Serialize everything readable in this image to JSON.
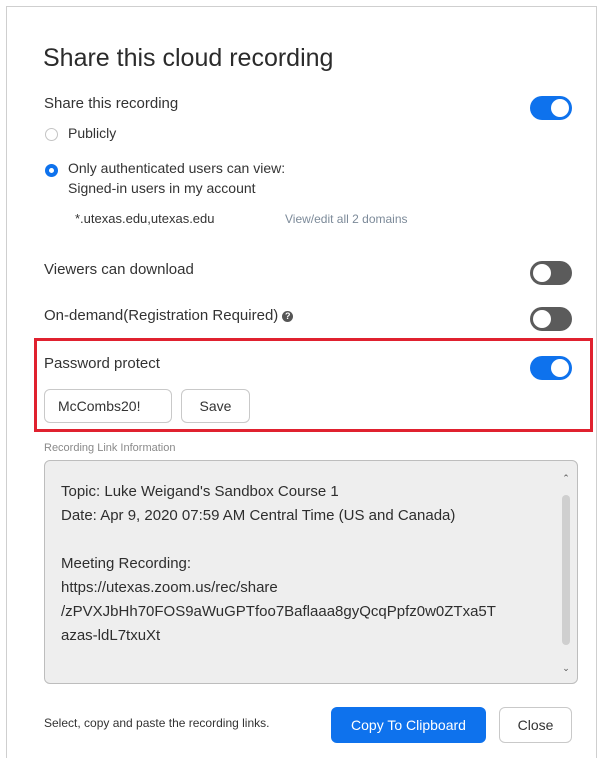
{
  "dialog": {
    "title": "Share this cloud recording"
  },
  "share": {
    "label": "Share this recording",
    "toggle_state": "on",
    "options": [
      {
        "label": "Publicly",
        "selected": false
      },
      {
        "label": "Only authenticated users can view:",
        "selected": true
      }
    ],
    "auth_detail": "Signed-in users in my account",
    "domains": "*.utexas.edu,utexas.edu",
    "domains_link": "View/edit all 2 domains"
  },
  "viewers_download": {
    "label": "Viewers can download",
    "toggle_state": "off"
  },
  "on_demand": {
    "label": "On-demand(Registration Required)",
    "help_icon": "question-circle-icon",
    "help_glyph": "?",
    "toggle_state": "off"
  },
  "password": {
    "label": "Password protect",
    "toggle_state": "on",
    "value": "McCombs20!",
    "save_label": "Save"
  },
  "link_info": {
    "section_label": "Recording Link Information",
    "topic": "Topic: Luke Weigand's Sandbox Course 1",
    "date": "Date: Apr 9, 2020 07:59 AM Central Time (US and Canada)",
    "meeting_label": "Meeting Recording:",
    "url_line1": "https://utexas.zoom.us/rec/share",
    "url_line2": "/zPVXJbHh70FOS9aWuGPTfoo7Baflaaa8gyQcqPpfz0w0ZTxa5T",
    "url_line3": "azas-ldL7txuXt",
    "scroll_up_glyph": "⌃",
    "scroll_down_glyph": "⌄"
  },
  "footer": {
    "hint": "Select, copy and paste the recording links.",
    "copy_label": "Copy To Clipboard",
    "close_label": "Close"
  },
  "colors": {
    "accent": "#0e72ed",
    "toggle_off": "#5b5b5b",
    "highlight_border": "#e0212f"
  }
}
